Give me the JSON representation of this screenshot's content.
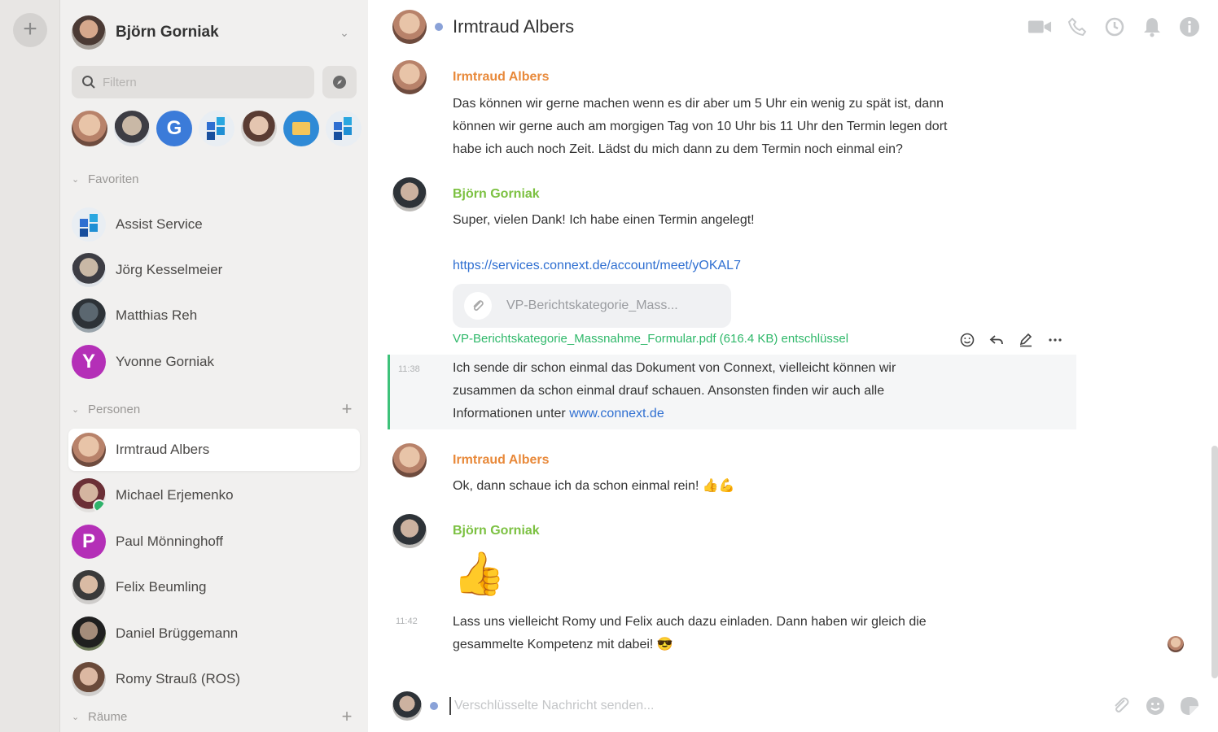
{
  "user": {
    "name": "Björn Gorniak"
  },
  "search": {
    "placeholder": "Filtern"
  },
  "quick_contacts": [
    {
      "name": "irmtraud-albers"
    },
    {
      "name": "joerg-kesselmeier"
    },
    {
      "name": "g-contact",
      "initial": "G"
    },
    {
      "name": "assist-service"
    },
    {
      "name": "contact-5"
    },
    {
      "name": "mail-contact"
    },
    {
      "name": "assist-service-2"
    }
  ],
  "sections": {
    "favorites": "Favoriten",
    "persons": "Personen",
    "rooms": "Räume"
  },
  "favorites": [
    {
      "label": "Assist Service"
    },
    {
      "label": "Jörg Kesselmeier"
    },
    {
      "label": "Matthias Reh"
    },
    {
      "label": "Yvonne Gorniak",
      "initial": "Y"
    }
  ],
  "persons": [
    {
      "label": "Irmtraud Albers"
    },
    {
      "label": "Michael Erjemenko"
    },
    {
      "label": "Paul Mönninghoff",
      "initial": "P"
    },
    {
      "label": "Felix Beumling"
    },
    {
      "label": "Daniel Brüggemann"
    },
    {
      "label": "Romy Strauß (ROS)"
    }
  ],
  "chat": {
    "title": "Irmtraud Albers",
    "messages": [
      {
        "sender": "Irmtraud Albers",
        "lines": [
          "Das können wir gerne machen wenn es dir aber um 5 Uhr ein wenig zu spät ist, dann",
          "können wir gerne auch am morgigen Tag von 10 Uhr bis 11 Uhr den Termin legen dort",
          "habe ich auch noch Zeit. Lädst du mich dann zu dem Termin noch einmal ein?"
        ]
      },
      {
        "sender": "Björn Gorniak",
        "text": "Super, vielen Dank! Ich habe einen Termin angelegt!",
        "link": "https://services.connext.de/account/meet/yOKAL7",
        "attachment_name": "VP-Berichtskategorie_Mass...",
        "file_line": "VP-Berichtskategorie_Massnahme_Formular.pdf (616.4 KB) entschlüssel"
      },
      {
        "time": "11:38",
        "lines": [
          "Ich sende dir schon einmal das Dokument von Connext, vielleicht können wir",
          "zusammen da schon einmal drauf schauen. Ansonsten finden wir auch alle"
        ],
        "line3_prefix": "Informationen unter ",
        "link": "www.connext.de"
      },
      {
        "sender": "Irmtraud Albers",
        "text": "Ok, dann schaue ich da schon einmal rein! 👍💪"
      },
      {
        "sender": "Björn Gorniak",
        "emoji": "👍",
        "time": "11:42",
        "lines": [
          "Lass uns vielleicht Romy und Felix auch dazu einladen. Dann haben wir gleich die",
          "gesammelte Kompetenz mit dabei! 😎"
        ]
      }
    ],
    "composer_placeholder": "Verschlüsselte Nachricht senden..."
  },
  "colors": {
    "accent": "#2f6fd1",
    "sender_orange": "#e8893a",
    "sender_green": "#7cc142",
    "file_green": "#2fb86a",
    "highlight_bar": "#3ec27a"
  },
  "icons": [
    "plus-icon",
    "search-icon",
    "compass-icon",
    "chevron-down-icon",
    "video-icon",
    "phone-icon",
    "clock-icon",
    "bell-icon",
    "info-icon",
    "paperclip-icon",
    "emoji-icon",
    "reply-icon",
    "edit-icon",
    "more-icon",
    "sticker-icon"
  ]
}
